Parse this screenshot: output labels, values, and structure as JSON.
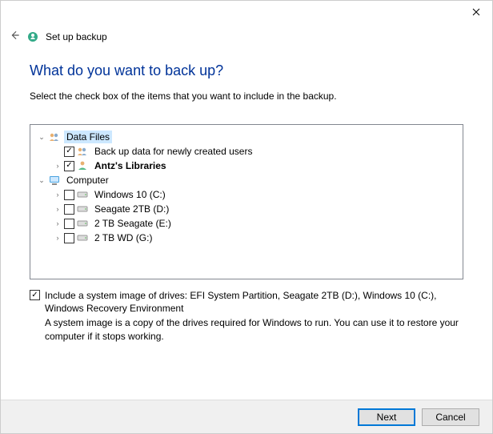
{
  "window": {
    "back_title": "Set up backup"
  },
  "page": {
    "question": "What do you want to back up?",
    "instruction": "Select the check box of the items that you want to include in the backup."
  },
  "tree": {
    "data_files_label": "Data Files",
    "new_users_label": "Back up data for newly created users",
    "user_lib_label": "Antz's Libraries",
    "computer_label": "Computer",
    "drives": {
      "c": "Windows 10 (C:)",
      "d": "Seagate 2TB (D:)",
      "e": "2 TB Seagate (E:)",
      "g": "2 TB WD (G:)"
    }
  },
  "sysimage": {
    "label": "Include a system image of drives: EFI System Partition, Seagate 2TB (D:), Windows 10 (C:), Windows Recovery Environment",
    "desc": "A system image is a copy of the drives required for Windows to run. You can use it to restore your computer if it stops working."
  },
  "buttons": {
    "next": "Next",
    "cancel": "Cancel"
  }
}
